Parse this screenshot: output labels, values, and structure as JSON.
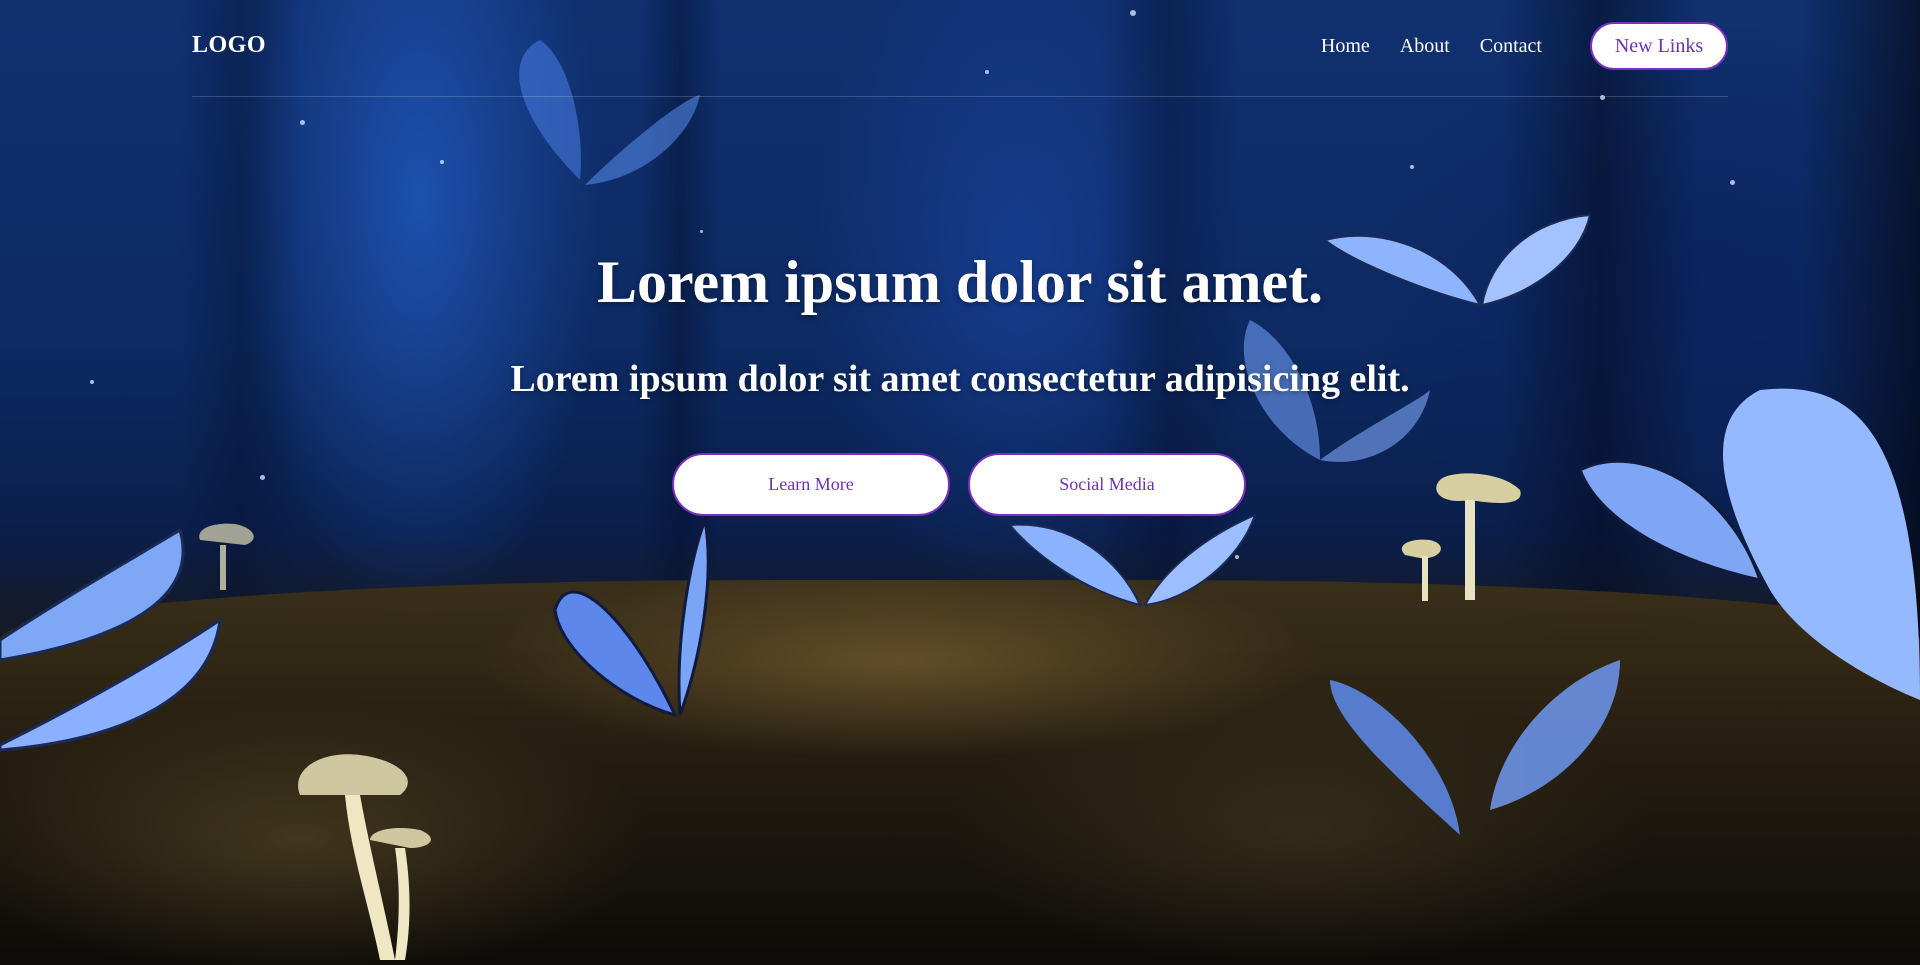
{
  "header": {
    "logo": "LOGO",
    "nav": {
      "home": "Home",
      "about": "About",
      "contact": "Contact"
    },
    "cta_label": "New Links"
  },
  "hero": {
    "headline": "Lorem ipsum dolor sit amet.",
    "subhead": "Lorem ipsum dolor sit amet consectetur adipisicing elit.",
    "buttons": {
      "learn_more": "Learn More",
      "social_media": "Social Media"
    },
    "background_icons": [
      "butterfly-icon",
      "mushroom-icon"
    ]
  },
  "colors": {
    "accent": "#6f31b8",
    "button_border": "#7b2fbf",
    "button_bg": "#ffffff",
    "text": "#ffffff"
  }
}
